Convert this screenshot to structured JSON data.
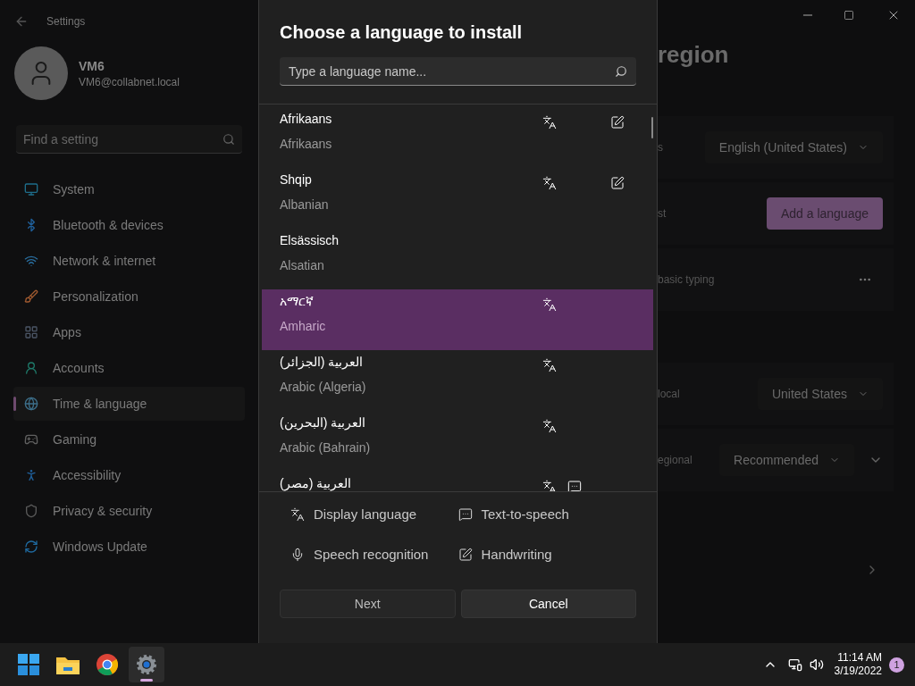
{
  "window": {
    "title": "Settings"
  },
  "user": {
    "name": "VM6",
    "email": "VM6@collabnet.local"
  },
  "search": {
    "placeholder": "Find a setting"
  },
  "nav": [
    {
      "label": "System",
      "selected": false
    },
    {
      "label": "Bluetooth & devices",
      "selected": false
    },
    {
      "label": "Network & internet",
      "selected": false
    },
    {
      "label": "Personalization",
      "selected": false
    },
    {
      "label": "Apps",
      "selected": false
    },
    {
      "label": "Accounts",
      "selected": false
    },
    {
      "label": "Time & language",
      "selected": true
    },
    {
      "label": "Gaming",
      "selected": false
    },
    {
      "label": "Accessibility",
      "selected": false
    },
    {
      "label": "Privacy & security",
      "selected": false
    },
    {
      "label": "Windows Update",
      "selected": false
    }
  ],
  "page": {
    "title": "region",
    "rows": [
      {
        "kind": "dropdown",
        "label": "s",
        "value": "English (United States)"
      },
      {
        "kind": "button",
        "label": "st",
        "value": "Add a language"
      },
      {
        "kind": "more",
        "label": "basic typing"
      },
      {
        "kind": "spacer"
      },
      {
        "kind": "dropdown",
        "label": "local",
        "value": "United States"
      },
      {
        "kind": "dropdown-expand",
        "label": "egional",
        "value": "Recommended"
      },
      {
        "kind": "spacer"
      },
      {
        "kind": "link"
      }
    ]
  },
  "dialog": {
    "title": "Choose a language to install",
    "search": {
      "placeholder": "Type a language name..."
    },
    "languages": [
      {
        "native": "Afrikaans",
        "english": "Afrikaans",
        "display_language": true,
        "text_to_speech": false,
        "handwriting": true,
        "selected": false
      },
      {
        "native": "Shqip",
        "english": "Albanian",
        "display_language": true,
        "text_to_speech": false,
        "handwriting": true,
        "selected": false
      },
      {
        "native": "Elsässisch",
        "english": "Alsatian",
        "display_language": false,
        "text_to_speech": false,
        "handwriting": false,
        "selected": false
      },
      {
        "native": "አማርኛ",
        "english": "Amharic",
        "display_language": true,
        "text_to_speech": false,
        "handwriting": false,
        "selected": true
      },
      {
        "native": "العربية (الجزائر)",
        "english": "Arabic (Algeria)",
        "display_language": true,
        "text_to_speech": false,
        "handwriting": false,
        "selected": false
      },
      {
        "native": "العربية (البحرين)",
        "english": "Arabic (Bahrain)",
        "display_language": true,
        "text_to_speech": false,
        "handwriting": false,
        "selected": false
      },
      {
        "native": "العربية (مصر)",
        "display_language": true,
        "text_to_speech": true,
        "handwriting": false,
        "selected": false
      }
    ],
    "legend": [
      "Display language",
      "Text-to-speech",
      "Speech recognition",
      "Handwriting"
    ],
    "buttons": [
      {
        "label": "Next",
        "kind": "primary"
      },
      {
        "label": "Cancel",
        "kind": "secondary"
      }
    ]
  },
  "taskbar": {
    "apps": [
      {
        "kind": "start",
        "active": false
      },
      {
        "kind": "folder",
        "active": false
      },
      {
        "kind": "browser",
        "active": false
      },
      {
        "kind": "gear",
        "active": true
      }
    ],
    "time": "11:14 AM",
    "date": "3/19/2022",
    "notifications": "1"
  }
}
